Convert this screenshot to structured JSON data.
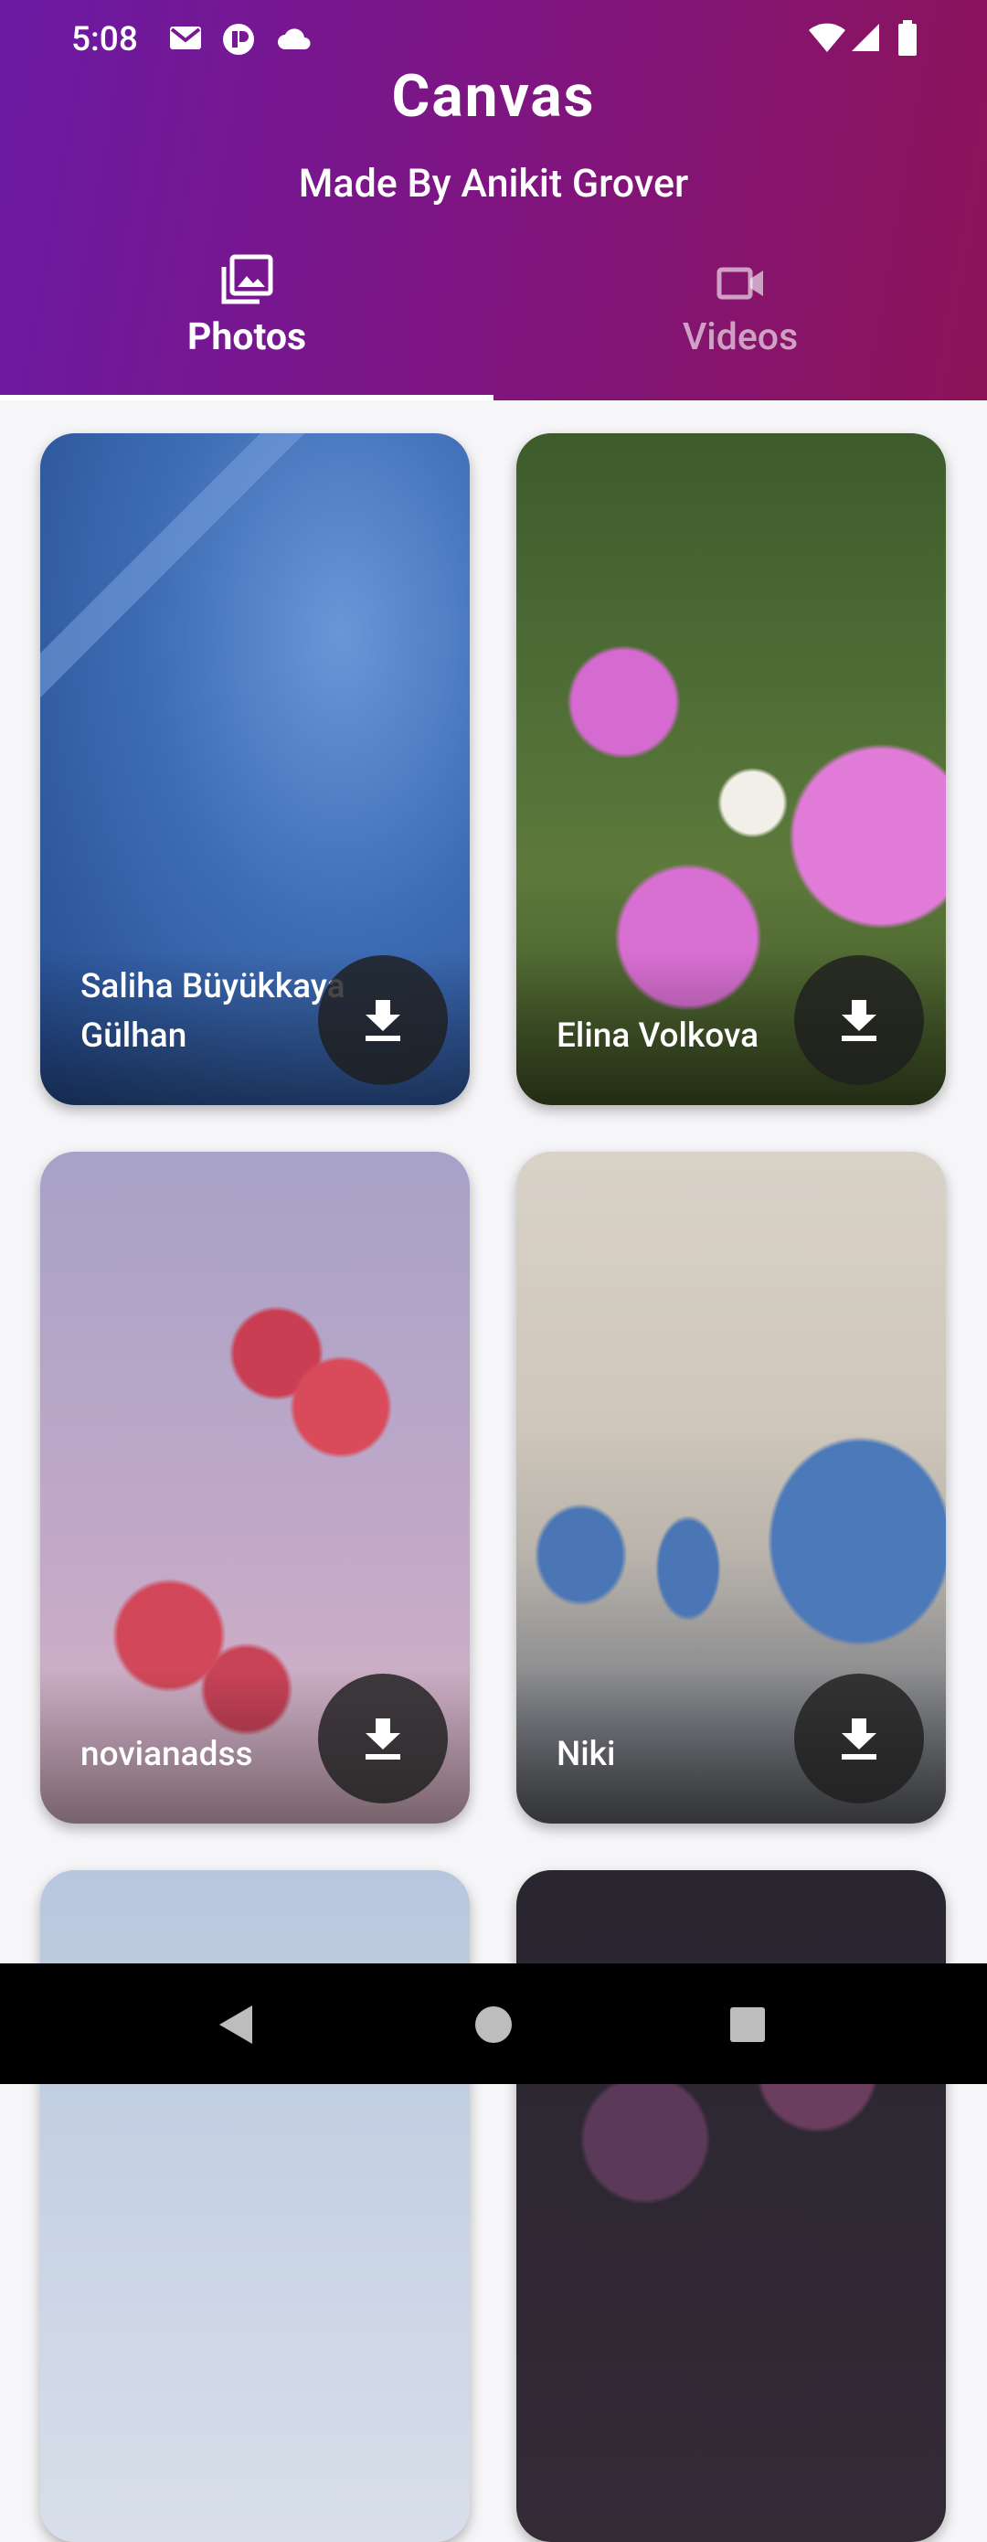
{
  "status": {
    "time": "5:08"
  },
  "header": {
    "title": "Canvas",
    "subtitle": "Made By Anikit Grover"
  },
  "tabs": [
    {
      "label": "Photos",
      "icon": "photo-library-icon",
      "selected": true
    },
    {
      "label": "Videos",
      "icon": "videocam-icon",
      "selected": false
    }
  ],
  "photos": [
    {
      "author": "Saliha Büyükkaya Gülhan",
      "image": "pool-steps-photo"
    },
    {
      "author": "Elina Volkova",
      "image": "dog-among-flowers-photo"
    },
    {
      "author": "novianadss",
      "image": "pink-flower-branch-photo"
    },
    {
      "author": "Niki",
      "image": "coffee-grinders-photo"
    }
  ],
  "colors": {
    "header_start": "#6b1aa3",
    "header_end": "#8d1358",
    "background": "#f6f6f8"
  }
}
